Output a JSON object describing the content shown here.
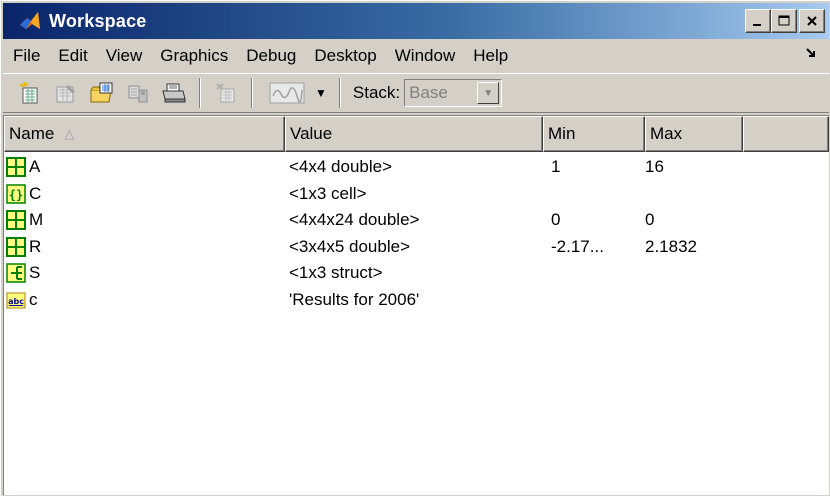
{
  "window": {
    "title": "Workspace",
    "controls": {
      "minimize": "_",
      "maximize": "□",
      "close": "X"
    }
  },
  "menu": {
    "items": [
      "File",
      "Edit",
      "View",
      "Graphics",
      "Debug",
      "Desktop",
      "Window",
      "Help"
    ],
    "dock_arrow": "↘"
  },
  "toolbar": {
    "icons": [
      "new-variable-icon",
      "open-selection-icon",
      "import-data-icon",
      "save-icon",
      "print-icon",
      "delete-icon",
      "plot-icon"
    ],
    "stack_label": "Stack:",
    "stack_value": "Base"
  },
  "table": {
    "columns": {
      "name": "Name",
      "value": "Value",
      "min": "Min",
      "max": "Max"
    },
    "sort_indicator": "△",
    "rows": [
      {
        "icon": "matrix-icon",
        "name": "A",
        "value": "<4x4 double>",
        "min": "1",
        "max": "16"
      },
      {
        "icon": "cell-icon",
        "name": "C",
        "value": "<1x3 cell>",
        "min": "",
        "max": ""
      },
      {
        "icon": "matrix-icon",
        "name": "M",
        "value": "<4x4x24 double>",
        "min": "0",
        "max": "0"
      },
      {
        "icon": "matrix-icon",
        "name": "R",
        "value": "<3x4x5 double>",
        "min": "-2.17...",
        "max": "2.1832"
      },
      {
        "icon": "struct-icon",
        "name": "S",
        "value": "<1x3 struct>",
        "min": "",
        "max": ""
      },
      {
        "icon": "char-icon",
        "name": "c",
        "value": "'Results for 2006'",
        "min": "",
        "max": ""
      }
    ]
  },
  "colors": {
    "titlebar_start": "#0a246a",
    "titlebar_end": "#a6caf0",
    "chrome": "#d4d0c8",
    "icon_yellow": "#ffff80",
    "icon_green": "#008000"
  }
}
